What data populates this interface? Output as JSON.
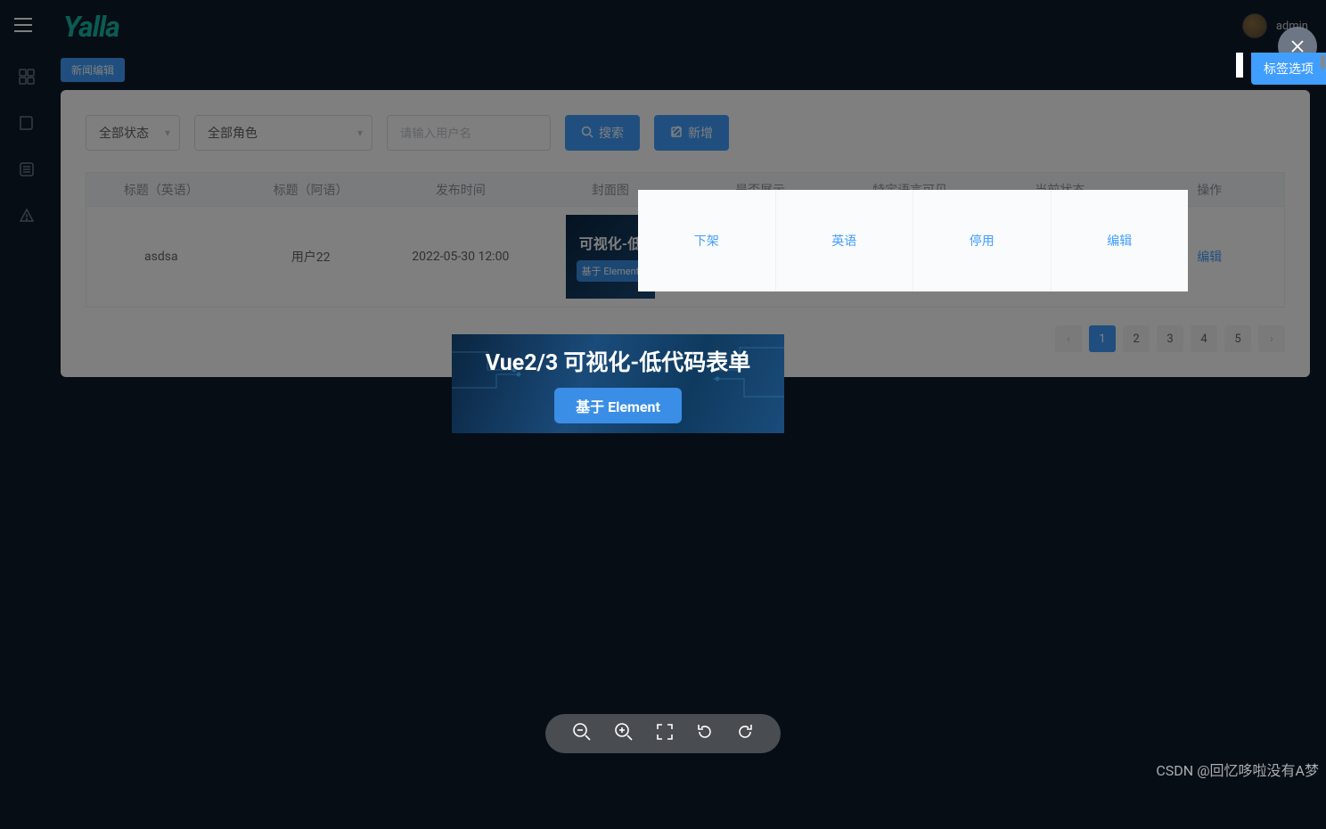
{
  "header": {
    "logo_text": "Yalla",
    "user_name": "admin"
  },
  "tab": {
    "label": "新闻编辑"
  },
  "tag_options_label": "标签选项",
  "filters": {
    "status_select": "全部状态",
    "role_select": "全部角色",
    "username_placeholder": "请输入用户名",
    "search_btn": "搜索",
    "add_btn": "新增"
  },
  "table": {
    "headers": [
      "标题（英语）",
      "标题（阿语）",
      "发布时间",
      "封面图",
      "是否展示",
      "特定语言可见",
      "当前状态",
      "操作"
    ],
    "row": {
      "title_en": "asdsa",
      "title_ar": "用户22",
      "publish_time": "2022-05-30 12:00",
      "thumb_text": "可视化-低",
      "thumb_btn": "基于 Element",
      "show": "下架",
      "lang": "英语",
      "status": "停用",
      "action": "编辑"
    }
  },
  "pagination": {
    "pages": [
      "1",
      "2",
      "3",
      "4",
      "5"
    ],
    "active": "1"
  },
  "preview": {
    "title": "Vue2/3 可视化-低代码表单",
    "btn": "基于 Element"
  },
  "watermark": "CSDN @回忆哆啦没有A梦"
}
